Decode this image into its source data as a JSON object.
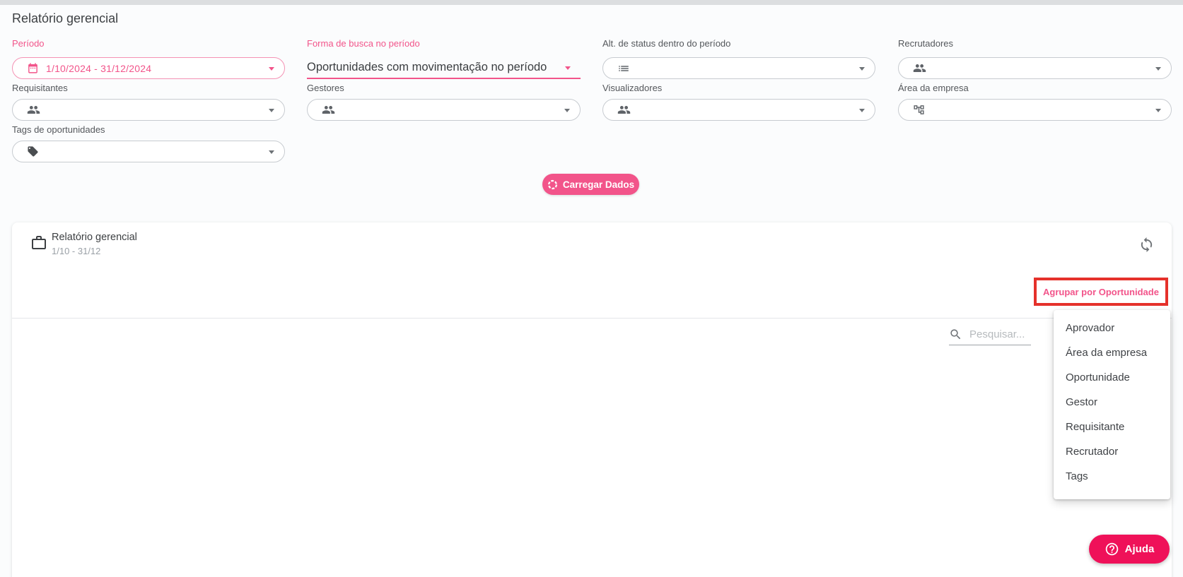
{
  "page": {
    "title": "Relatório gerencial"
  },
  "filters": {
    "periodo_label": "Período",
    "periodo_value": "1/10/2024 - 31/12/2024",
    "forma_busca_label": "Forma de busca no período",
    "forma_busca_value": "Oportunidades com movimentação no período",
    "alt_status_label": "Alt. de status dentro do período",
    "recrutadores_label": "Recrutadores",
    "requisitantes_label": "Requisitantes",
    "gestores_label": "Gestores",
    "visualizadores_label": "Visualizadores",
    "area_empresa_label": "Área da empresa",
    "tags_label": "Tags de oportunidades"
  },
  "buttons": {
    "load_data": "Carregar Dados",
    "group_by": "Agrupar por Oportunidade",
    "help": "Ajuda"
  },
  "report_card": {
    "title": "Relatório gerencial",
    "period": "1/10 - 31/12",
    "search_placeholder": "Pesquisar..."
  },
  "group_menu": {
    "items": [
      "Aprovador",
      "Área da empresa",
      "Oportunidade",
      "Gestor",
      "Requisitante",
      "Recrutador",
      "Tags"
    ]
  },
  "colors": {
    "theme_pink": "#f2548a",
    "help_pink": "#ef1159",
    "annotation_red": "#e5312b"
  }
}
